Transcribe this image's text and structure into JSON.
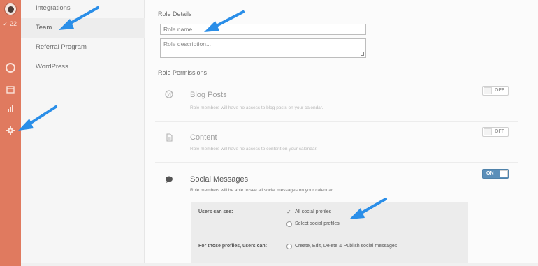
{
  "rail": {
    "count_label": "✓ 22"
  },
  "sidebar": {
    "items": [
      {
        "label": "Integrations"
      },
      {
        "label": "Team"
      },
      {
        "label": "Referral Program"
      },
      {
        "label": "WordPress"
      }
    ]
  },
  "main": {
    "role_details_title": "Role Details",
    "role_name_placeholder": "Role name...",
    "role_description_placeholder": "Role description...",
    "role_permissions_title": "Role Permissions",
    "permissions": [
      {
        "icon": "wordpress-icon",
        "title": "Blog Posts",
        "description": "Role members will have no access to blog posts on your calendar.",
        "toggle": "OFF"
      },
      {
        "icon": "document-icon",
        "title": "Content",
        "description": "Role members will have no access to content on your calendar.",
        "toggle": "OFF"
      },
      {
        "icon": "chat-bubble-icon",
        "title": "Social Messages",
        "description": "Role members will be able to see all social messages on your calendar.",
        "toggle": "ON"
      }
    ],
    "social_box": {
      "users_can_see_label": "Users can see:",
      "option_all": "All social profiles",
      "option_select": "Select social profiles",
      "for_profiles_label": "For those profiles, users can:",
      "option_publish": "Create, Edit, Delete & Publish social messages"
    }
  },
  "colors": {
    "rail": "#e07a5f",
    "toggle_on": "#5b8fb9",
    "arrow": "#2a8ee8"
  }
}
